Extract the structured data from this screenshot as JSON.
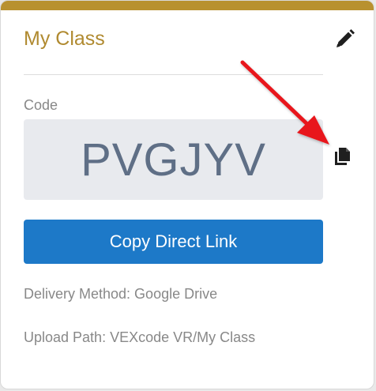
{
  "card": {
    "title": "My Class",
    "accent_color": "#b8912f",
    "edit_icon": "pencil-icon"
  },
  "code": {
    "label": "Code",
    "value": "PVGJYV",
    "copy_icon": "copy-icon"
  },
  "actions": {
    "copy_direct_link_label": "Copy Direct Link",
    "button_color": "#1d79c8"
  },
  "info": {
    "delivery_method": "Delivery Method: Google Drive",
    "upload_path": "Upload Path: VEXcode VR/My Class"
  },
  "annotation": {
    "arrow_color": "#e8141b"
  }
}
